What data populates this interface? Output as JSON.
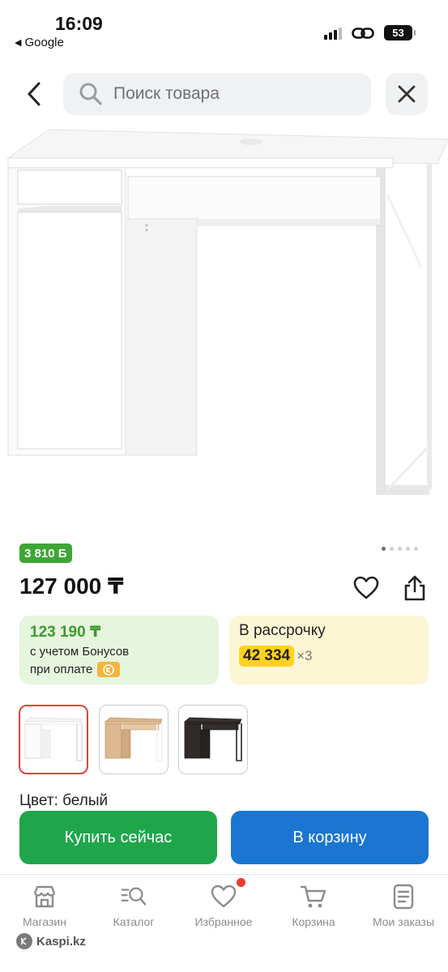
{
  "status_bar": {
    "time": "16:09",
    "back_app": "Google",
    "battery": "53"
  },
  "header": {
    "search_placeholder": "Поиск товара",
    "back_icon": "chevron-left-icon",
    "close_icon": "close-icon"
  },
  "product": {
    "bonus_badge": "3 810 Б",
    "price": "127 000 ₸",
    "image_pager": {
      "count": 5,
      "active_index": 0
    }
  },
  "bonus_offer": {
    "price": "123 190 ₸",
    "line1": "с учетом Бонусов",
    "line2": "при оплате"
  },
  "installment": {
    "title": "В рассрочку",
    "amount": "42 334",
    "multiplier": "×3"
  },
  "variants": [
    {
      "color": "white",
      "selected": true
    },
    {
      "color": "oak",
      "selected": false
    },
    {
      "color": "black-brown",
      "selected": false
    }
  ],
  "color_label": "Цвет: белый",
  "actions": {
    "buy_now": "Купить сейчас",
    "add_to_cart": "В корзину"
  },
  "tabbar": [
    {
      "label": "Магазин",
      "icon": "store-icon"
    },
    {
      "label": "Каталог",
      "icon": "catalog-search-icon"
    },
    {
      "label": "Избранное",
      "icon": "heart-icon",
      "badge": true
    },
    {
      "label": "Корзина",
      "icon": "cart-icon"
    },
    {
      "label": "Мои заказы",
      "icon": "orders-icon"
    }
  ],
  "watermark": "Kaspi.kz",
  "colors": {
    "green": "#1fa64b",
    "blue": "#1a76d1",
    "bonus_green": "#3fa635",
    "installment_yellow": "#ffd21d",
    "selected_border": "#e0443b"
  }
}
